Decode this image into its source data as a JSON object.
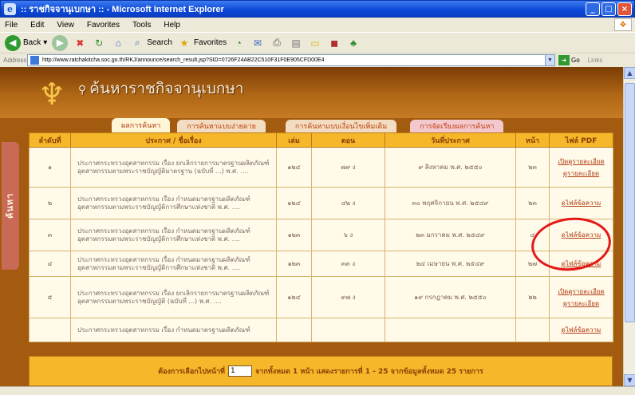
{
  "window": {
    "title": ":: ราชกิจจานุเบกษา :: - Microsoft Internet Explorer",
    "buttons": {
      "minimize": "_",
      "maximize": "□",
      "close": "×"
    }
  },
  "menu": [
    "File",
    "Edit",
    "View",
    "Favorites",
    "Tools",
    "Help"
  ],
  "toolbar": {
    "back": "Back",
    "search": "Search",
    "favorites": "Favorites"
  },
  "address": {
    "label": "Address",
    "url": "http://www.ratchakitcha.soc.go.th/RKJ/announce/search_result.jsp?SID=0726F24AB22C510F31F0E905CFD00E4",
    "go": "Go",
    "links": "Links"
  },
  "site": {
    "title": "ค้นหาราชกิจจานุเบกษา",
    "side_tab": "ค้นหา"
  },
  "tabs": [
    {
      "label": "ผลการค้นหา",
      "active": true
    },
    {
      "label": "การค้นหาแบบง่ายดาย",
      "active": false
    },
    {
      "label": "การค้นหาแบบเงื่อนไขเพิ่มเติม",
      "active": false
    },
    {
      "label": "การจัดเรียงผลการค้นหา",
      "active": false
    }
  ],
  "table": {
    "headers": [
      "ลำดับที่",
      "ประกาศ / ชื่อเรื่อง",
      "เล่ม",
      "ตอน",
      "วันที่ประกาศ",
      "หน้า",
      "ไฟล์ PDF"
    ],
    "rows": [
      {
        "no": "๑",
        "subject": "ประกาศกระทรวงอุตสาหกรรม เรื่อง ยกเลิกรายการมาตรฐานผลิตภัณฑ์อุตสาหกรรมตามพระราชบัญญัติมาตรฐาน (ฉบับที่ ...) พ.ศ. ....",
        "volume": "๑๒๔",
        "section": "๗๙ ง",
        "date": "๙ สิงหาคม พ.ศ. ๒๕๕๐",
        "page": "๒๓",
        "pdf": [
          "เปิดดูรายละเอียด",
          "ดูรายละเอียด"
        ]
      },
      {
        "no": "๒",
        "subject": "ประกาศกระทรวงอุตสาหกรรม เรื่อง กำหนดมาตรฐานผลิตภัณฑ์อุตสาหกรรมตามพระราชบัญญัติการศึกษาแห่งชาติ พ.ศ. ....",
        "volume": "๑๒๔",
        "section": "๔๒ ง",
        "date": "๓๐ พฤศจิกายน พ.ศ. ๒๕๔๙",
        "page": "๒๓",
        "pdf": [
          "ดูไฟล์ข้อความ"
        ]
      },
      {
        "no": "๓",
        "subject": "ประกาศกระทรวงอุตสาหกรรม เรื่อง กำหนดมาตรฐานผลิตภัณฑ์อุตสาหกรรมตามพระราชบัญญัติการศึกษาแห่งชาติ พ.ศ. ....",
        "volume": "๑๒๓",
        "section": "๖ ง",
        "date": "๒๓ มกราคม พ.ศ. ๒๕๔๙",
        "page": "๔",
        "pdf": [
          "ดูไฟล์ข้อความ"
        ]
      },
      {
        "no": "๔",
        "subject": "ประกาศกระทรวงอุตสาหกรรม เรื่อง กำหนดมาตรฐานผลิตภัณฑ์อุตสาหกรรมตามพระราชบัญญัติการศึกษาแห่งชาติ พ.ศ. ....",
        "volume": "๑๒๓",
        "section": "๓๓ ง",
        "date": "๒๔ เมษายน พ.ศ. ๒๕๔๙",
        "page": "๒๗",
        "pdf": [
          "ดูไฟล์ข้อความ"
        ]
      },
      {
        "no": "๕",
        "subject": "ประกาศกระทรวงอุตสาหกรรม เรื่อง ยกเลิกรายการมาตรฐานผลิตภัณฑ์อุตสาหกรรมตามพระราชบัญญัติ (ฉบับที่ ...) พ.ศ. ....",
        "volume": "๑๒๔",
        "section": "๙๗ ง",
        "date": "๑๙ กรกฎาคม พ.ศ. ๒๕๕๐",
        "page": "๒๒",
        "pdf": [
          "เปิดดูรายละเอียด",
          "ดูรายละเอียด"
        ]
      },
      {
        "no": "",
        "subject": "ประกาศกระทรวงอุตสาหกรรม เรื่อง กำหนดมาตรฐานผลิตภัณฑ์",
        "volume": "",
        "section": "",
        "date": "",
        "page": "",
        "pdf": [
          "ดูไฟล์ข้อความ"
        ]
      }
    ]
  },
  "footer": {
    "prefix": "ต้องการเลือกไปหน้าที่",
    "page_value": "1",
    "summary": "จากทั้งหมด 1 หน้า แสดงรายการที่ 1 - 25 จากข้อมูลทั้งหมด 25 รายการ"
  }
}
